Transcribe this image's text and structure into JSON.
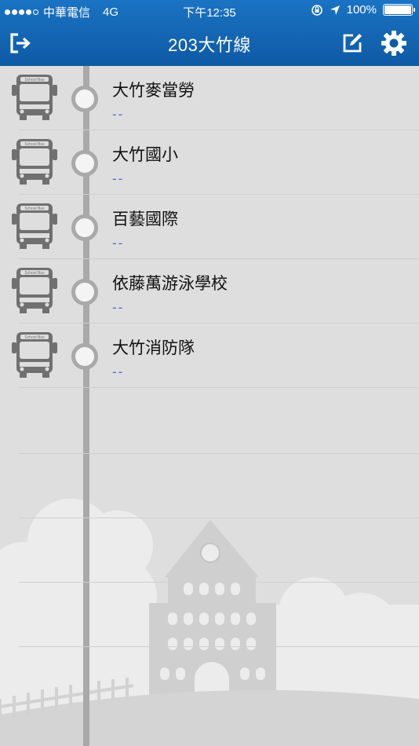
{
  "status_bar": {
    "carrier": "中華電信",
    "network": "4G",
    "time": "下午12:35",
    "battery": "100%"
  },
  "nav": {
    "title": "203大竹線"
  },
  "stops": [
    {
      "name": "大竹麥當勞",
      "eta": "--"
    },
    {
      "name": "大竹國小",
      "eta": "--"
    },
    {
      "name": "百藝國際",
      "eta": "--"
    },
    {
      "name": "依藤萬游泳學校",
      "eta": "--"
    },
    {
      "name": "大竹消防隊",
      "eta": "--"
    }
  ],
  "bus_sign": "School Bus",
  "colors": {
    "nav_blue": "#166bb8",
    "eta_blue": "#3b6fe0",
    "timeline_gray": "#a9a9a9",
    "background": "#dedede"
  }
}
